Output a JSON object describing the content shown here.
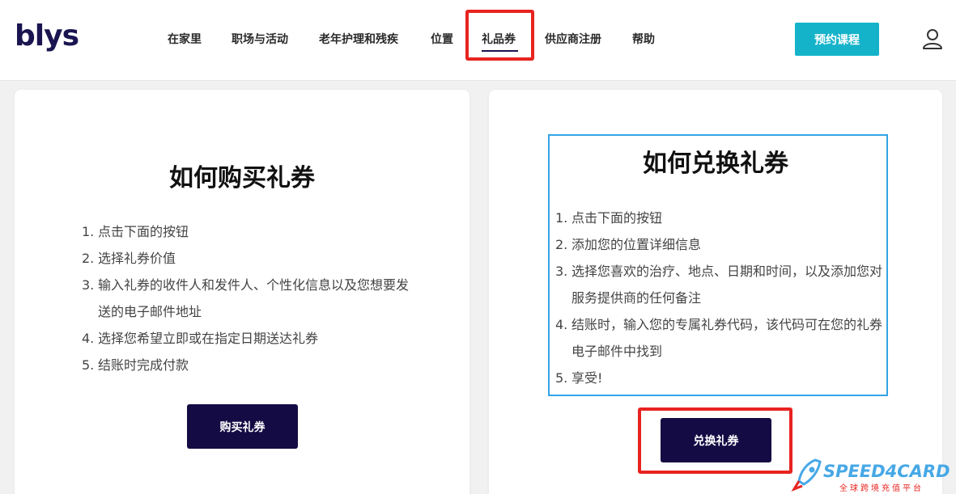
{
  "header": {
    "logo": "blys",
    "nav": [
      {
        "label": "在家里"
      },
      {
        "label": "职场与活动"
      },
      {
        "label": "老年护理和残疾"
      },
      {
        "label": "位置"
      },
      {
        "label": "礼品券",
        "active": true
      },
      {
        "label": "供应商注册"
      },
      {
        "label": "帮助"
      }
    ],
    "book_button": "预约课程",
    "user_icon": "user-icon"
  },
  "buy_card": {
    "title": "如何购买礼券",
    "steps": [
      {
        "num": "1.",
        "text": "点击下面的按钮"
      },
      {
        "num": "2.",
        "text": "选择礼券价值"
      },
      {
        "num": "3.",
        "text": "输入礼券的收件人和发件人、个性化信息以及您想要发送的电子邮件地址"
      },
      {
        "num": "4.",
        "text": "选择您希望立即或在指定日期送达礼券"
      },
      {
        "num": "5.",
        "text": "结账时完成付款"
      }
    ],
    "button": "购买礼券"
  },
  "redeem_card": {
    "title": "如何兑换礼券",
    "steps": [
      {
        "num": "1.",
        "text": "点击下面的按钮"
      },
      {
        "num": "2.",
        "text": "添加您的位置详细信息"
      },
      {
        "num": "3.",
        "text": "选择您喜欢的治疗、地点、日期和时间，以及添加您对服务提供商的任何备注"
      },
      {
        "num": "4.",
        "text": "结账时，输入您的专属礼券代码，该代码可在您的礼券电子邮件中找到"
      },
      {
        "num": "5.",
        "text": "享受!"
      }
    ],
    "button": "兑换礼券"
  },
  "watermark": {
    "brand": "SPEED4CARD",
    "tagline": "全球跨境充值平台"
  },
  "colors": {
    "brand_dark": "#150b44",
    "accent_teal": "#15b3c9",
    "highlight_red": "#e8231f",
    "highlight_blue": "#33a4e6"
  }
}
